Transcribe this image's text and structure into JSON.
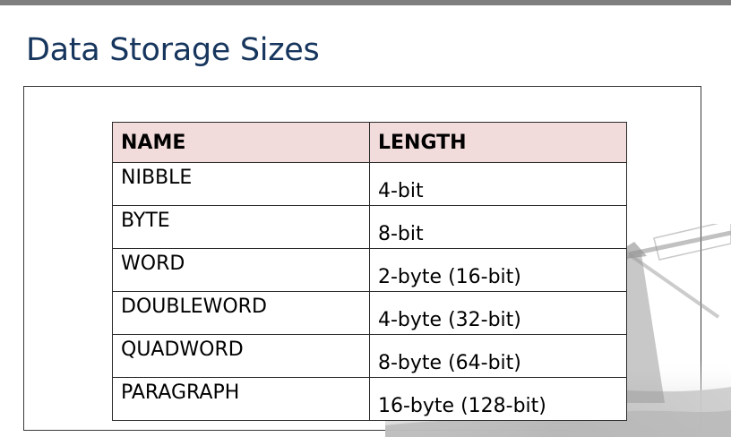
{
  "slide": {
    "title": "Data Storage Sizes"
  },
  "table": {
    "columns": [
      "NAME",
      "LENGTH"
    ],
    "rows": [
      {
        "name": "NIBBLE",
        "length": "4-bit"
      },
      {
        "name": "BYTE",
        "length": "8-bit"
      },
      {
        "name": "WORD",
        "length": "2-byte (16-bit)"
      },
      {
        "name": "DOUBLEWORD",
        "length": "4-byte (32-bit)"
      },
      {
        "name": "QUADWORD",
        "length": "8-byte (64-bit)"
      },
      {
        "name": "PARAGRAPH",
        "length": "16-byte (128-bit)"
      }
    ]
  },
  "colors": {
    "title": "#17365d",
    "header_fill": "#f2dcdb",
    "top_bar": "#7f7f7f",
    "border": "#2b2b2b"
  },
  "decor": {
    "background_image": "windmill-watermark-image"
  }
}
